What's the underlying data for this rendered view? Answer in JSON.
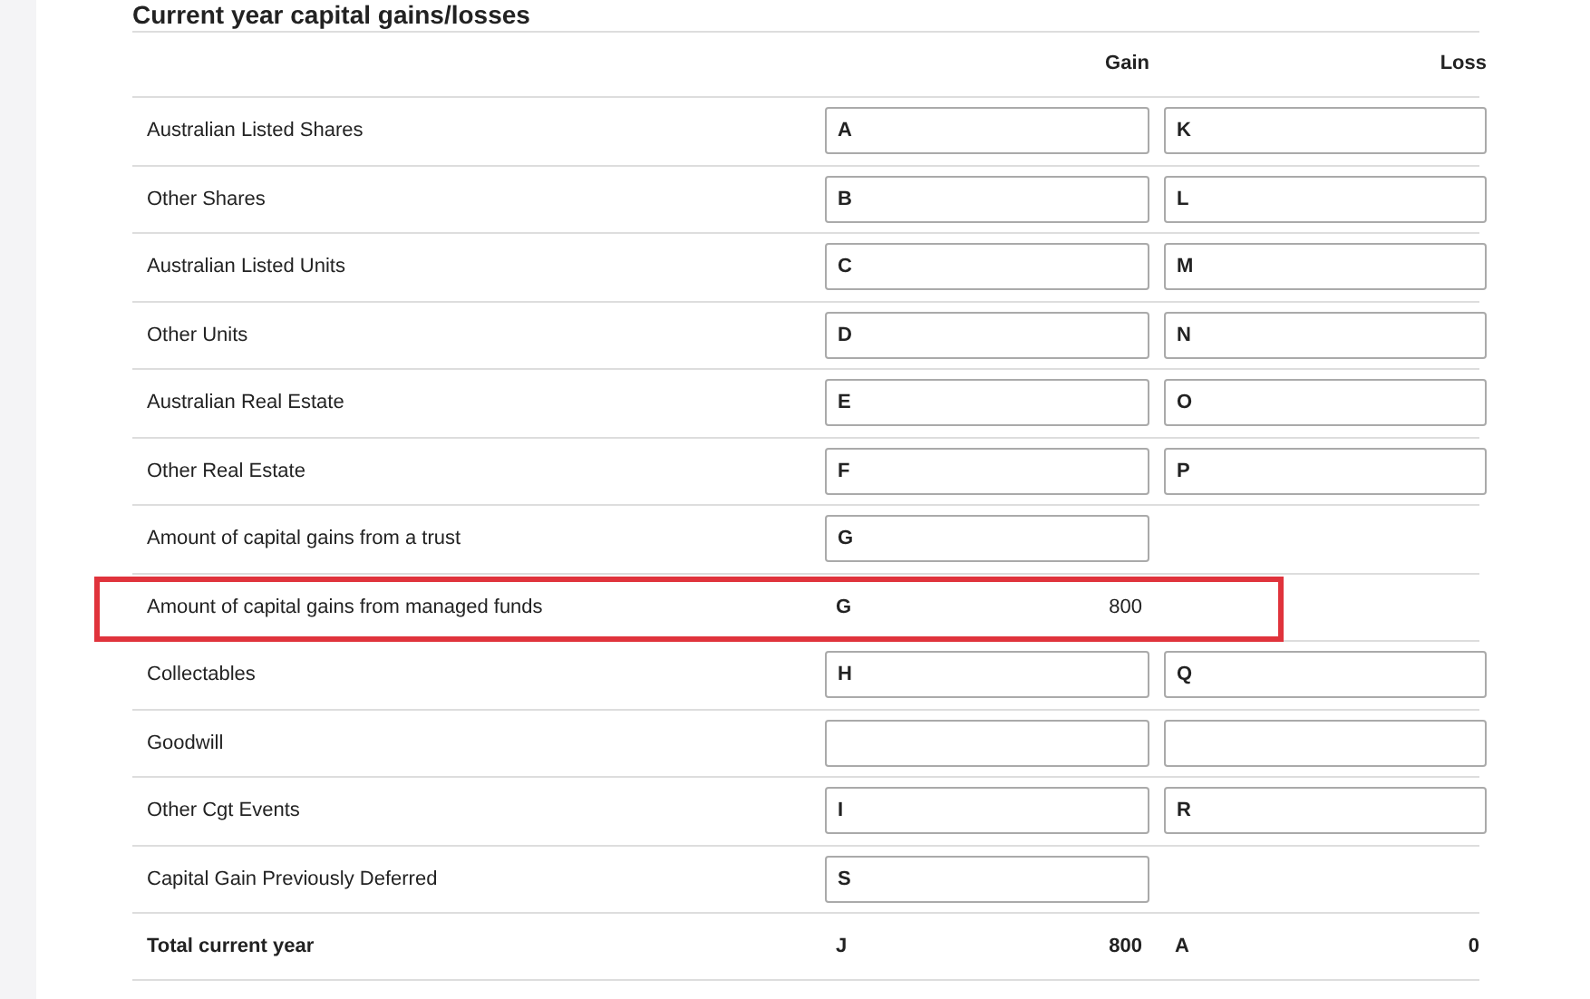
{
  "section_title": "Current year capital gains/losses",
  "columns": [
    "Gain",
    "Loss"
  ],
  "rows": [
    {
      "label": "Australian Listed Shares",
      "kind": "input",
      "gain": {
        "letter": "A"
      },
      "loss": {
        "letter": "K"
      }
    },
    {
      "label": "Other Shares",
      "kind": "input",
      "gain": {
        "letter": "B"
      },
      "loss": {
        "letter": "L"
      }
    },
    {
      "label": "Australian Listed Units",
      "kind": "input",
      "gain": {
        "letter": "C"
      },
      "loss": {
        "letter": "M"
      }
    },
    {
      "label": "Other Units",
      "kind": "input",
      "gain": {
        "letter": "D"
      },
      "loss": {
        "letter": "N"
      }
    },
    {
      "label": "Australian Real Estate",
      "kind": "input",
      "gain": {
        "letter": "E"
      },
      "loss": {
        "letter": "O"
      }
    },
    {
      "label": "Other Real Estate",
      "kind": "input",
      "gain": {
        "letter": "F"
      },
      "loss": {
        "letter": "P"
      }
    },
    {
      "label": "Amount of capital gains from a trust",
      "kind": "input",
      "gain": {
        "letter": "G"
      }
    },
    {
      "label": "Amount of capital gains from managed funds",
      "kind": "plain",
      "highlighted": true,
      "gain": {
        "letter": "G",
        "value": "800"
      }
    },
    {
      "label": "Collectables",
      "kind": "input",
      "gain": {
        "letter": "H"
      },
      "loss": {
        "letter": "Q"
      }
    },
    {
      "label": "Goodwill",
      "kind": "input",
      "gain": {},
      "loss": {}
    },
    {
      "label": "Other Cgt Events",
      "kind": "input",
      "gain": {
        "letter": "I"
      },
      "loss": {
        "letter": "R"
      }
    },
    {
      "label": "Capital Gain Previously Deferred",
      "kind": "input",
      "gain": {
        "letter": "S"
      }
    },
    {
      "label": "Total current year",
      "kind": "total",
      "gain": {
        "letter": "J",
        "value": "800"
      },
      "loss": {
        "letter": "A",
        "value": "0"
      }
    }
  ]
}
